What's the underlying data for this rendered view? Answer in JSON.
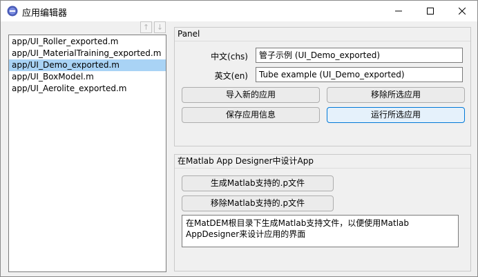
{
  "window": {
    "title": "应用编辑器",
    "controls": {
      "minimize_icon": "minimize-icon",
      "maximize_icon": "maximize-icon",
      "close_icon": "close-icon"
    }
  },
  "app_list": {
    "items": [
      {
        "label": "app/UI_Roller_exported.m",
        "selected": false
      },
      {
        "label": "app/UI_MaterialTraining_exported.m",
        "selected": false
      },
      {
        "label": "app/UI_Demo_exported.m",
        "selected": true
      },
      {
        "label": "app/UI_BoxModel.m",
        "selected": false
      },
      {
        "label": "app/UI_Aerolite_exported.m",
        "selected": false
      }
    ],
    "move_up_symbol": "↑",
    "move_down_symbol": "↓"
  },
  "panel": {
    "title": "Panel",
    "chs_label": "中文(chs)",
    "chs_value": "管子示例 (UI_Demo_exported)",
    "en_label": "英文(en)",
    "en_value": "Tube example (UI_Demo_exported)",
    "import_button": "导入新的应用",
    "remove_button": "移除所选应用",
    "save_button": "保存应用信息",
    "run_button": "运行所选应用"
  },
  "designer_panel": {
    "title": "在Matlab App Designer中设计App",
    "generate_button": "生成Matlab支持的.p文件",
    "remove_p_button": "移除Matlab支持的.p文件",
    "description": "在MatDEM根目录下生成Matlab支持文件，以便使用Matlab AppDesigner来设计应用的界面"
  },
  "colors": {
    "selection": "#a9d3f5",
    "focus_border": "#0078d7",
    "app_icon": "#4a5cb8"
  }
}
